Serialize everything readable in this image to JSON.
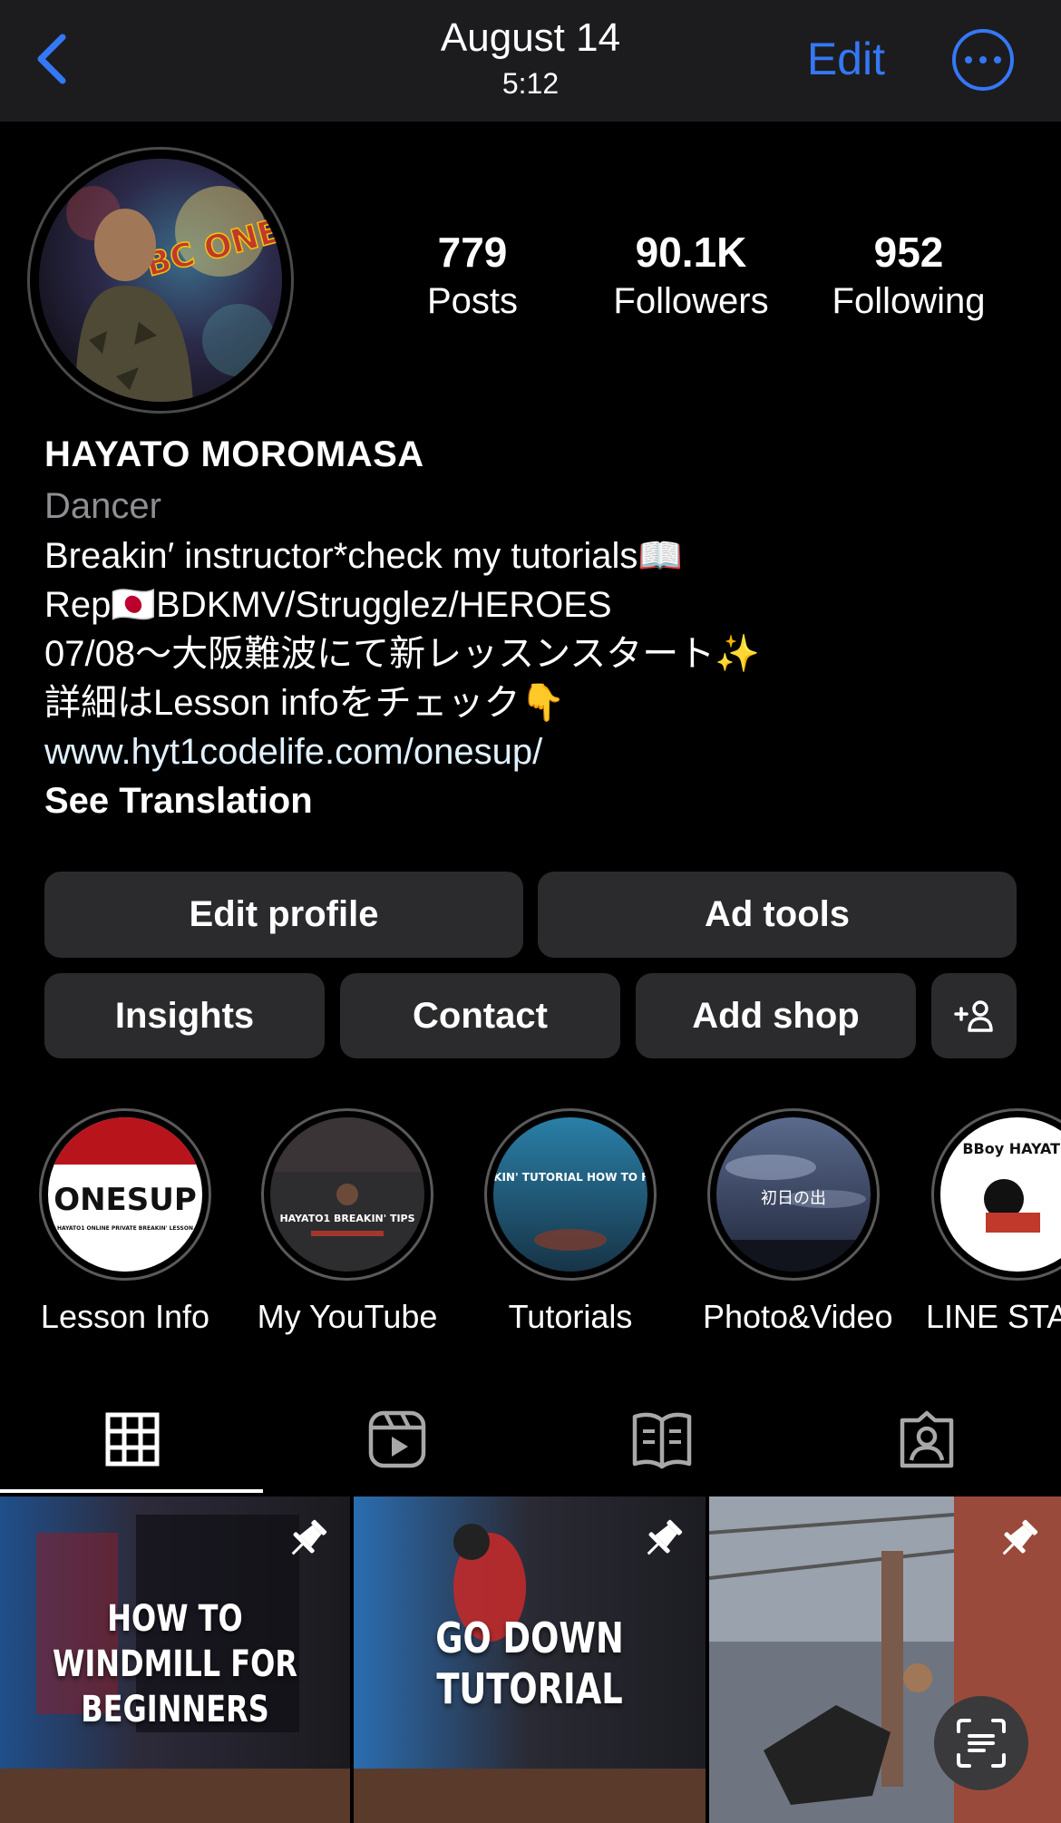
{
  "topbar": {
    "date": "August 14",
    "time": "5:12",
    "edit_label": "Edit",
    "back_icon": "chevron-left-icon",
    "more_icon": "more-ellipsis-icon",
    "accent_color": "#3478f6"
  },
  "profile": {
    "stats": [
      {
        "value": "779",
        "label": "Posts"
      },
      {
        "value": "90.1K",
        "label": "Followers"
      },
      {
        "value": "952",
        "label": "Following"
      }
    ],
    "name": "HAYATO MOROMASA",
    "category": "Dancer",
    "bio_lines": [
      "Breakin′ instructor*check my tutorials📖",
      "Rep🇯🇵BDKMV/Strugglez/HEROES",
      "07/08〜大阪難波にて新レッスンスタート✨",
      "詳細はLesson infoをチェック👇"
    ],
    "link": "www.hyt1codelife.com/onesup/",
    "translation_label": "See Translation",
    "avatar_text": "BC ONE"
  },
  "buttons": {
    "edit_profile": "Edit profile",
    "ad_tools": "Ad tools",
    "insights": "Insights",
    "contact": "Contact",
    "add_shop": "Add shop",
    "add_person_icon": "add-person-icon"
  },
  "highlights": [
    {
      "label": "Lesson Info",
      "cover_text": "ONESUP",
      "cover_sub": "HAYATO1 ONLINE PRIVATE BREAKIN' LESSON"
    },
    {
      "label": "My YouTube",
      "cover_text": "HAYATO1 BREAKIN' TIPS"
    },
    {
      "label": "Tutorials",
      "cover_text": "BREAKIN' TUTORIAL HOW TO FLARE"
    },
    {
      "label": "Photo&Video",
      "cover_text": "初日の出"
    },
    {
      "label": "LINE STA",
      "cover_text": "BBoy HAYATO"
    }
  ],
  "tabs": [
    {
      "name": "grid-icon",
      "active": true
    },
    {
      "name": "reels-icon",
      "active": false
    },
    {
      "name": "guides-icon",
      "active": false
    },
    {
      "name": "tagged-icon",
      "active": false
    }
  ],
  "posts": [
    {
      "title": "HOW TO WINDMILL FOR BEGINNERS",
      "pinned": true
    },
    {
      "title": "GO DOWN TUTORIAL",
      "pinned": true
    },
    {
      "title": "",
      "pinned": true
    }
  ],
  "fab_icon": "scan-text-icon"
}
